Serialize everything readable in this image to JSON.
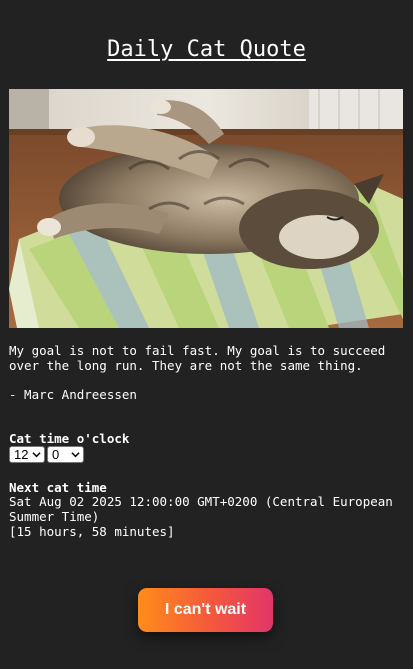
{
  "page": {
    "title": "Daily Cat Quote"
  },
  "image": {
    "alt": "Fluffy tabby cat stretching on a striped cushion"
  },
  "quote": {
    "text": "My goal is not to fail fast. My goal is to succeed over the long run. They are not the same thing.",
    "author": "- Marc Andreessen"
  },
  "cat_time": {
    "label": "Cat time o'clock",
    "hour": "12",
    "minute": "0"
  },
  "next_cat_time": {
    "label": "Next cat time",
    "datetime": "Sat Aug 02 2025 12:00:00 GMT+0200 (Central European Summer Time)",
    "remaining": "[15 hours, 58 minutes]"
  },
  "button": {
    "label": "I can't wait"
  },
  "colors": {
    "background": "#222222",
    "text": "#ffffff",
    "button_gradient_start": "#ff8c1a",
    "button_gradient_end": "#e2356a"
  }
}
